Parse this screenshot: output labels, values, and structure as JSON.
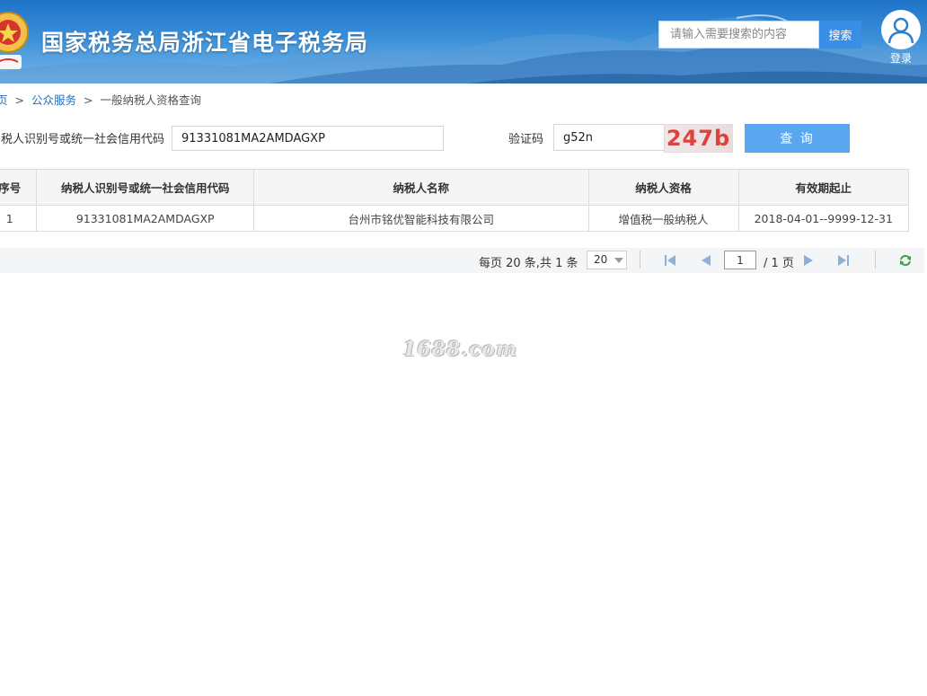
{
  "header": {
    "site_title": "国家税务总局浙江省电子税务局",
    "search_placeholder": "请输入需要搜索的内容",
    "search_button": "搜索",
    "login_label": "登录"
  },
  "breadcrumb": {
    "home": "页",
    "sep1": ">",
    "public_service": "公众服务",
    "sep2": ">",
    "current": "一般纳税人资格查询"
  },
  "query": {
    "taxpayer_id_label": "纳税人识别号或统一社会信用代码",
    "taxpayer_id_value": "91331081MA2AMDAGXP",
    "captcha_label": "验证码",
    "captcha_value": "g52n",
    "captcha_image_text": "247b",
    "query_button": "查 询"
  },
  "table": {
    "headers": [
      "序号",
      "纳税人识别号或统一社会信用代码",
      "纳税人名称",
      "纳税人资格",
      "有效期起止"
    ],
    "rows": [
      [
        "1",
        "91331081MA2AMDAGXP",
        "台州市铭优智能科技有限公司",
        "增值税一般纳税人",
        "2018-04-01--9999-12-31"
      ]
    ]
  },
  "pager": {
    "summary": "每页 20 条,共 1 条",
    "page_size": "20",
    "current_page": "1",
    "total_pages": "/ 1 页"
  },
  "watermark": "1688.com",
  "colors": {
    "header_blue": "#1f74c8",
    "search_button": "#3b8ee6",
    "query_button": "#5aa7f0",
    "link": "#2a6ebd",
    "captcha_text": "#e0413b"
  },
  "icons": [
    "emblem-icon",
    "user-icon",
    "first-page-icon",
    "prev-page-icon",
    "next-page-icon",
    "last-page-icon",
    "refresh-icon"
  ]
}
